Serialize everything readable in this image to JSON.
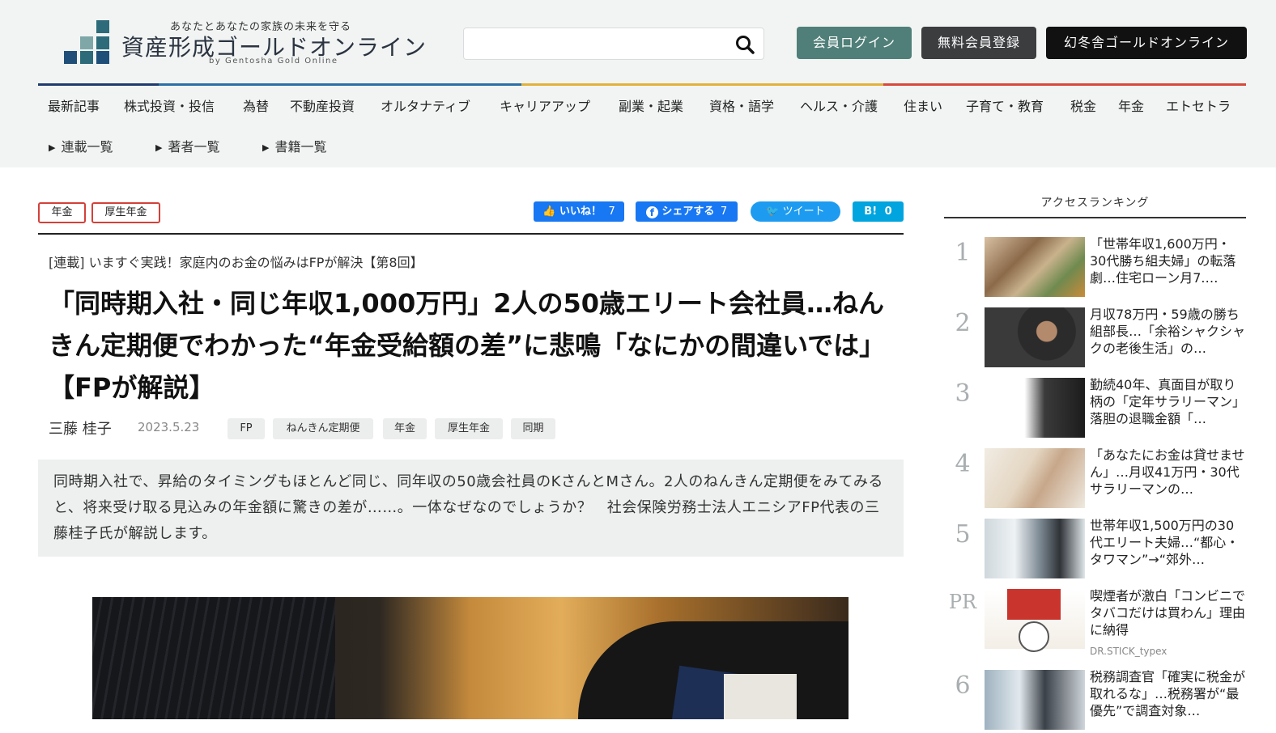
{
  "header": {
    "tagline": "あなたとあなたの家族の未来を守る",
    "site_name": "資産形成ゴールドオンライン",
    "byline": "by Gentosha Gold Online",
    "search_placeholder": "",
    "buttons": {
      "login": "会員ログイン",
      "register": "無料会員登録",
      "gentosha": "幻冬舎ゴールドオンライン"
    },
    "colors": {
      "login": "#4f7f78",
      "register": "#3b3d3f",
      "gentosha": "#111111"
    }
  },
  "nav": {
    "items": [
      "最新記事",
      "株式投資・投信",
      "為替",
      "不動産投資",
      "オルタナティブ",
      "キャリアアップ",
      "副業・起業",
      "資格・語学",
      "ヘルス・介護",
      "住まい",
      "子育て・教育",
      "税金",
      "年金",
      "エトセトラ"
    ],
    "sub_items": [
      "連載一覧",
      "著者一覧",
      "書籍一覧"
    ],
    "line_colors": [
      "#1f3b6e",
      "#2a6fa7",
      "#e2b13c",
      "#d9483b"
    ]
  },
  "article": {
    "category_tags": [
      "年金",
      "厚生年金"
    ],
    "social": {
      "like_label": "いいね！",
      "like_count": "7",
      "share_label": "シェアする",
      "share_count": "7",
      "tweet_label": "ツイート",
      "hatena_label": "B!",
      "hatena_count": "0",
      "colors": {
        "like": "#1877f2",
        "share": "#1877f2",
        "tweet": "#1d9bf0",
        "hatena": "#00a4de"
      }
    },
    "series": "[連載] いますぐ実践！家庭内のお金の悩みはFPが解決【第8回】",
    "title": "「同時期入社・同じ年収1,000万円」2人の50歳エリート会社員…ねんきん定期便でわかった“年金受給額の差”に悲鳴「なにかの間違いでは」【FPが解説】",
    "author": "三藤 桂子",
    "date": "2023.5.23",
    "keywords": [
      "FP",
      "ねんきん定期便",
      "年金",
      "厚生年金",
      "同期"
    ],
    "lead": "同時期入社で、昇給のタイミングもほとんど同じ、同年収の50歳会社員のKさんとMさん。2人のねんきん定期便をみてみると、将来受け取る見込みの年金額に驚きの差が……。一体なぜなのでしょうか？　社会保険労務士法人エニシアFP代表の三藤桂子氏が解説します。"
  },
  "sidebar": {
    "title": "アクセスランキング",
    "ranking": [
      {
        "rank": "1",
        "text": "「世帯年収1,600万円・30代勝ち組夫婦」の転落劇…住宅ローン月7.…"
      },
      {
        "rank": "2",
        "text": "月収78万円・59歳の勝ち組部長…「余裕シャクシャクの老後生活」の…"
      },
      {
        "rank": "3",
        "text": "勤続40年、真面目が取り柄の「定年サラリーマン」落胆の退職金額「…"
      },
      {
        "rank": "4",
        "text": "「あなたにお金は貸せません」…月収41万円・30代サラリーマンの…"
      },
      {
        "rank": "5",
        "text": "世帯年収1,500万円の30代エリート夫婦…“都心・タワマン”→“郊外…"
      },
      {
        "rank": "PR",
        "text": "喫煙者が激白「コンビニでタバコだけは買わん」理由に納得",
        "source": "DR.STICK_typex"
      },
      {
        "rank": "6",
        "text": "税務調査官「確実に税金が取れるな」…税務署が“最優先”で調査対象…"
      }
    ]
  }
}
